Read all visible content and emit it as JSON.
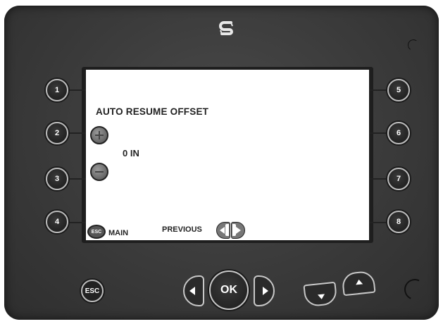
{
  "device": {
    "logo_icon": "brand-s-icon"
  },
  "screen": {
    "title": "AUTO RESUME OFFSET",
    "value": "0 IN",
    "increase_icon": "plus-circle-icon",
    "decrease_icon": "minus-circle-icon",
    "esc_badge": "ESC",
    "main_label": "MAIN",
    "previous_label": "PREVIOUS"
  },
  "softkeys": {
    "left": [
      "1",
      "2",
      "3",
      "4"
    ],
    "right": [
      "5",
      "6",
      "7",
      "8"
    ]
  },
  "hardkeys": {
    "esc": "ESC",
    "ok": "OK"
  },
  "colors": {
    "bezel": "#3a3a3a",
    "screen_bg": "#ffffff",
    "key_ring": "#bdbdbd"
  }
}
